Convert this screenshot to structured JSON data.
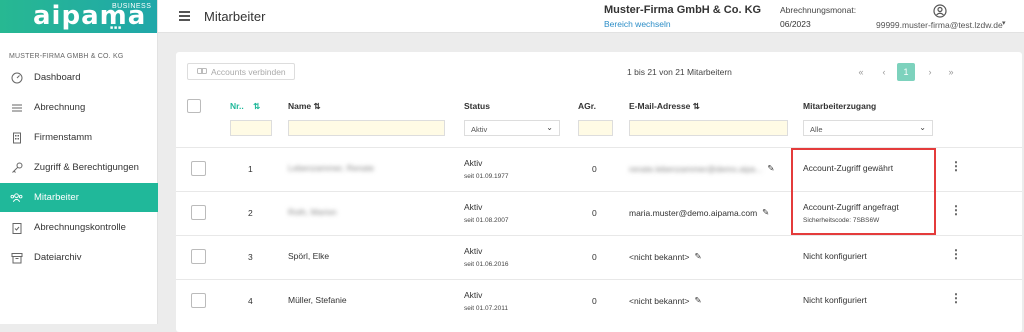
{
  "logo": {
    "brand": "aipama",
    "business": "BUSINESS"
  },
  "sidebar": {
    "company": "MUSTER-FIRMA GMBH & CO. KG",
    "items": [
      {
        "label": "Dashboard"
      },
      {
        "label": "Abrechnung"
      },
      {
        "label": "Firmenstamm"
      },
      {
        "label": "Zugriff & Berechtigungen"
      },
      {
        "label": "Mitarbeiter"
      },
      {
        "label": "Abrechnungskontrolle"
      },
      {
        "label": "Dateiarchiv"
      }
    ]
  },
  "header": {
    "title": "Mitarbeiter",
    "firm": "Muster-Firma GmbH & Co. KG",
    "switch_label": "Bereich wechseln",
    "month_label": "Abrechnungsmonat:",
    "month_value": "06/2023",
    "user_email": "99999.muster-firma@test.lzdw.de"
  },
  "toolbar": {
    "connect_label": "Accounts verbinden",
    "page_info": "1 bis 21 von 21 Mitarbeitern",
    "current_page": "1"
  },
  "table": {
    "headers": {
      "nr": "Nr..",
      "name": "Name",
      "status": "Status",
      "agr": "AGr.",
      "email": "E-Mail-Adresse",
      "access": "Mitarbeiterzugang"
    },
    "filters": {
      "status": "Aktiv",
      "access": "Alle"
    },
    "rows": [
      {
        "nr": "1",
        "name": "Lebenzammer, Renate",
        "status": "Aktiv",
        "since": "seit 01.09.1977",
        "agr": "0",
        "email": "renate.lebenzammer@demo.aipa...",
        "access": "Account-Zugriff gewährt",
        "secondary": ""
      },
      {
        "nr": "2",
        "name": "Roth, Marion",
        "status": "Aktiv",
        "since": "seit 01.08.2007",
        "agr": "0",
        "email": "maria.muster@demo.aipama.com",
        "access": "Account-Zugriff angefragt",
        "secondary": "Sicherheitscode: 7SBS6W"
      },
      {
        "nr": "3",
        "name": "Spörl, Elke",
        "status": "Aktiv",
        "since": "seit 01.06.2016",
        "agr": "0",
        "email": "<nicht bekannt>",
        "access": "Nicht konfiguriert",
        "secondary": ""
      },
      {
        "nr": "4",
        "name": "Müller, Stefanie",
        "status": "Aktiv",
        "since": "seit 01.07.2011",
        "agr": "0",
        "email": "<nicht bekannt>",
        "access": "Nicht konfiguriert",
        "secondary": ""
      }
    ]
  },
  "colors": {
    "accent": "#20b89a",
    "link": "#2b8dc7",
    "highlight": "#e43b3b"
  }
}
